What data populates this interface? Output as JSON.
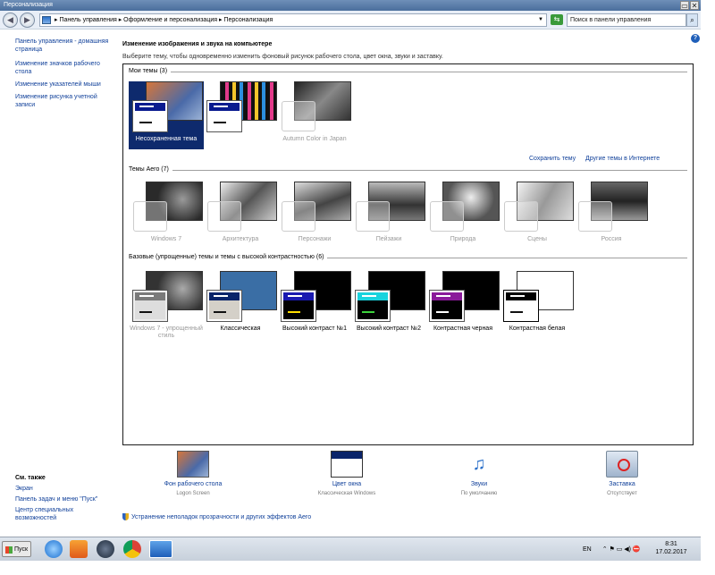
{
  "window": {
    "title": "Персонализация",
    "controls": [
      "▭",
      "✕"
    ]
  },
  "address": {
    "path": "▸ Панель управления ▸ Оформление и персонализация ▸ Персонализация",
    "search_placeholder": "Поиск в панели управления",
    "back": "◀",
    "forward": "▶"
  },
  "help": "?",
  "sidebar": {
    "items": [
      {
        "label": "Панель управления - домашняя страница"
      },
      {
        "label": "Изменение значков рабочего стола"
      },
      {
        "label": "Изменение указателей мыши"
      },
      {
        "label": "Изменение рисунка учетной записи"
      }
    ]
  },
  "see_also": {
    "title": "См. также",
    "items": [
      {
        "label": "Экран"
      },
      {
        "label": "Панель задач и меню \"Пуск\""
      },
      {
        "label": "Центр специальных возможностей"
      }
    ]
  },
  "main": {
    "heading": "Изменение изображения и звука на компьютере",
    "subheading": "Выберите тему, чтобы одновременно изменить фоновый рисунок рабочего стола, цвет окна, звуки и заставку."
  },
  "my_themes": {
    "title": "Мои темы (3)",
    "tiles": [
      {
        "label": "Несохраненная тема"
      },
      {
        "label": ""
      },
      {
        "label": "Autumn Color in Japan"
      }
    ],
    "save_link": "Сохранить тему",
    "more_link": "Другие темы в Интернете"
  },
  "aero_themes": {
    "title": "Темы Aero (7)",
    "tiles": [
      {
        "label": "Windows 7"
      },
      {
        "label": "Архитектура"
      },
      {
        "label": "Персонажи"
      },
      {
        "label": "Пейзажи"
      },
      {
        "label": "Природа"
      },
      {
        "label": "Сцены"
      },
      {
        "label": "Россия"
      }
    ]
  },
  "basic_themes": {
    "title": "Базовые (упрощенные) темы и темы с высокой контрастностью (6)",
    "tiles": [
      {
        "label": "Windows 7 - упрощенный стиль"
      },
      {
        "label": "Классическая"
      },
      {
        "label": "Высокий контраст №1"
      },
      {
        "label": "Высокий контраст №2"
      },
      {
        "label": "Контрастная черная"
      },
      {
        "label": "Контрастная белая"
      }
    ]
  },
  "bottom": {
    "items": [
      {
        "label": "Фон рабочего стола",
        "sub": "Logon Screen"
      },
      {
        "label": "Цвет окна",
        "sub": "Классическая Windows"
      },
      {
        "label": "Звуки",
        "sub": "По умолчанию"
      },
      {
        "label": "Заставка",
        "sub": "Отсутствует"
      }
    ],
    "troubleshoot": "Устранение неполадок прозрачности и других эффектов Aero"
  },
  "taskbar": {
    "start": "Пуск",
    "lang": "EN",
    "time": "8:31",
    "date": "17.02.2017"
  }
}
